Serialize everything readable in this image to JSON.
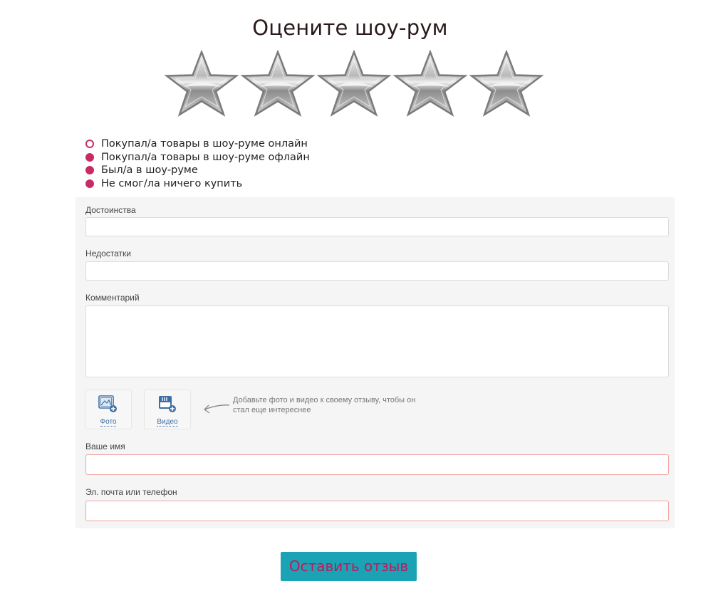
{
  "title": "Оцените шоу-рум",
  "rating": {
    "max": 5,
    "selected": 0,
    "star_icon": "star-icon"
  },
  "purchase_options": [
    {
      "label": "Покупал/а товары в шоу-руме онлайн",
      "state": "empty"
    },
    {
      "label": "Покупал/а товары в шоу-руме офлайн",
      "state": "filled"
    },
    {
      "label": "Был/а в шоу-руме",
      "state": "filled"
    },
    {
      "label": "Не смог/ла ничего купить",
      "state": "filled"
    }
  ],
  "form": {
    "advantages_label": "Достоинства",
    "advantages_value": "",
    "disadvantages_label": "Недостатки",
    "disadvantages_value": "",
    "comment_label": "Комментарий",
    "comment_value": "",
    "photo_label": "Фото",
    "video_label": "Видео",
    "media_hint": "Добавьте фото и видео к своему отзыву, чтобы он стал еще интереснее",
    "name_label": "Ваше имя",
    "name_value": "",
    "contact_label": "Эл. почта или телефон",
    "contact_value": ""
  },
  "submit_label": "Оставить отзыв",
  "colors": {
    "accent": "#c92a66",
    "button_bg": "#1aa3b5",
    "button_text": "#c2185b",
    "panel_bg": "#f5f5f5",
    "required_border": "#f1a5a5"
  }
}
